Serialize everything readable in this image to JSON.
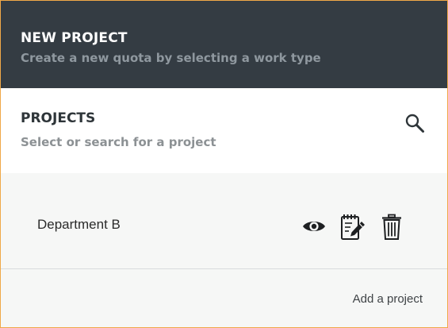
{
  "header": {
    "title": "NEW PROJECT",
    "subtitle": "Create a new quota by selecting a work type"
  },
  "projects": {
    "title": "PROJECTS",
    "subtitle": "Select or search for a project",
    "search_icon": "search-icon"
  },
  "list": {
    "items": [
      {
        "name": "Department B",
        "actions": [
          "eye-icon",
          "edit-notepad-icon",
          "trash-icon"
        ]
      }
    ],
    "add_label": "Add a project"
  },
  "colors": {
    "header_bg": "#343c43",
    "list_bg": "#f6f7f6",
    "frame_border": "#f0a848"
  }
}
